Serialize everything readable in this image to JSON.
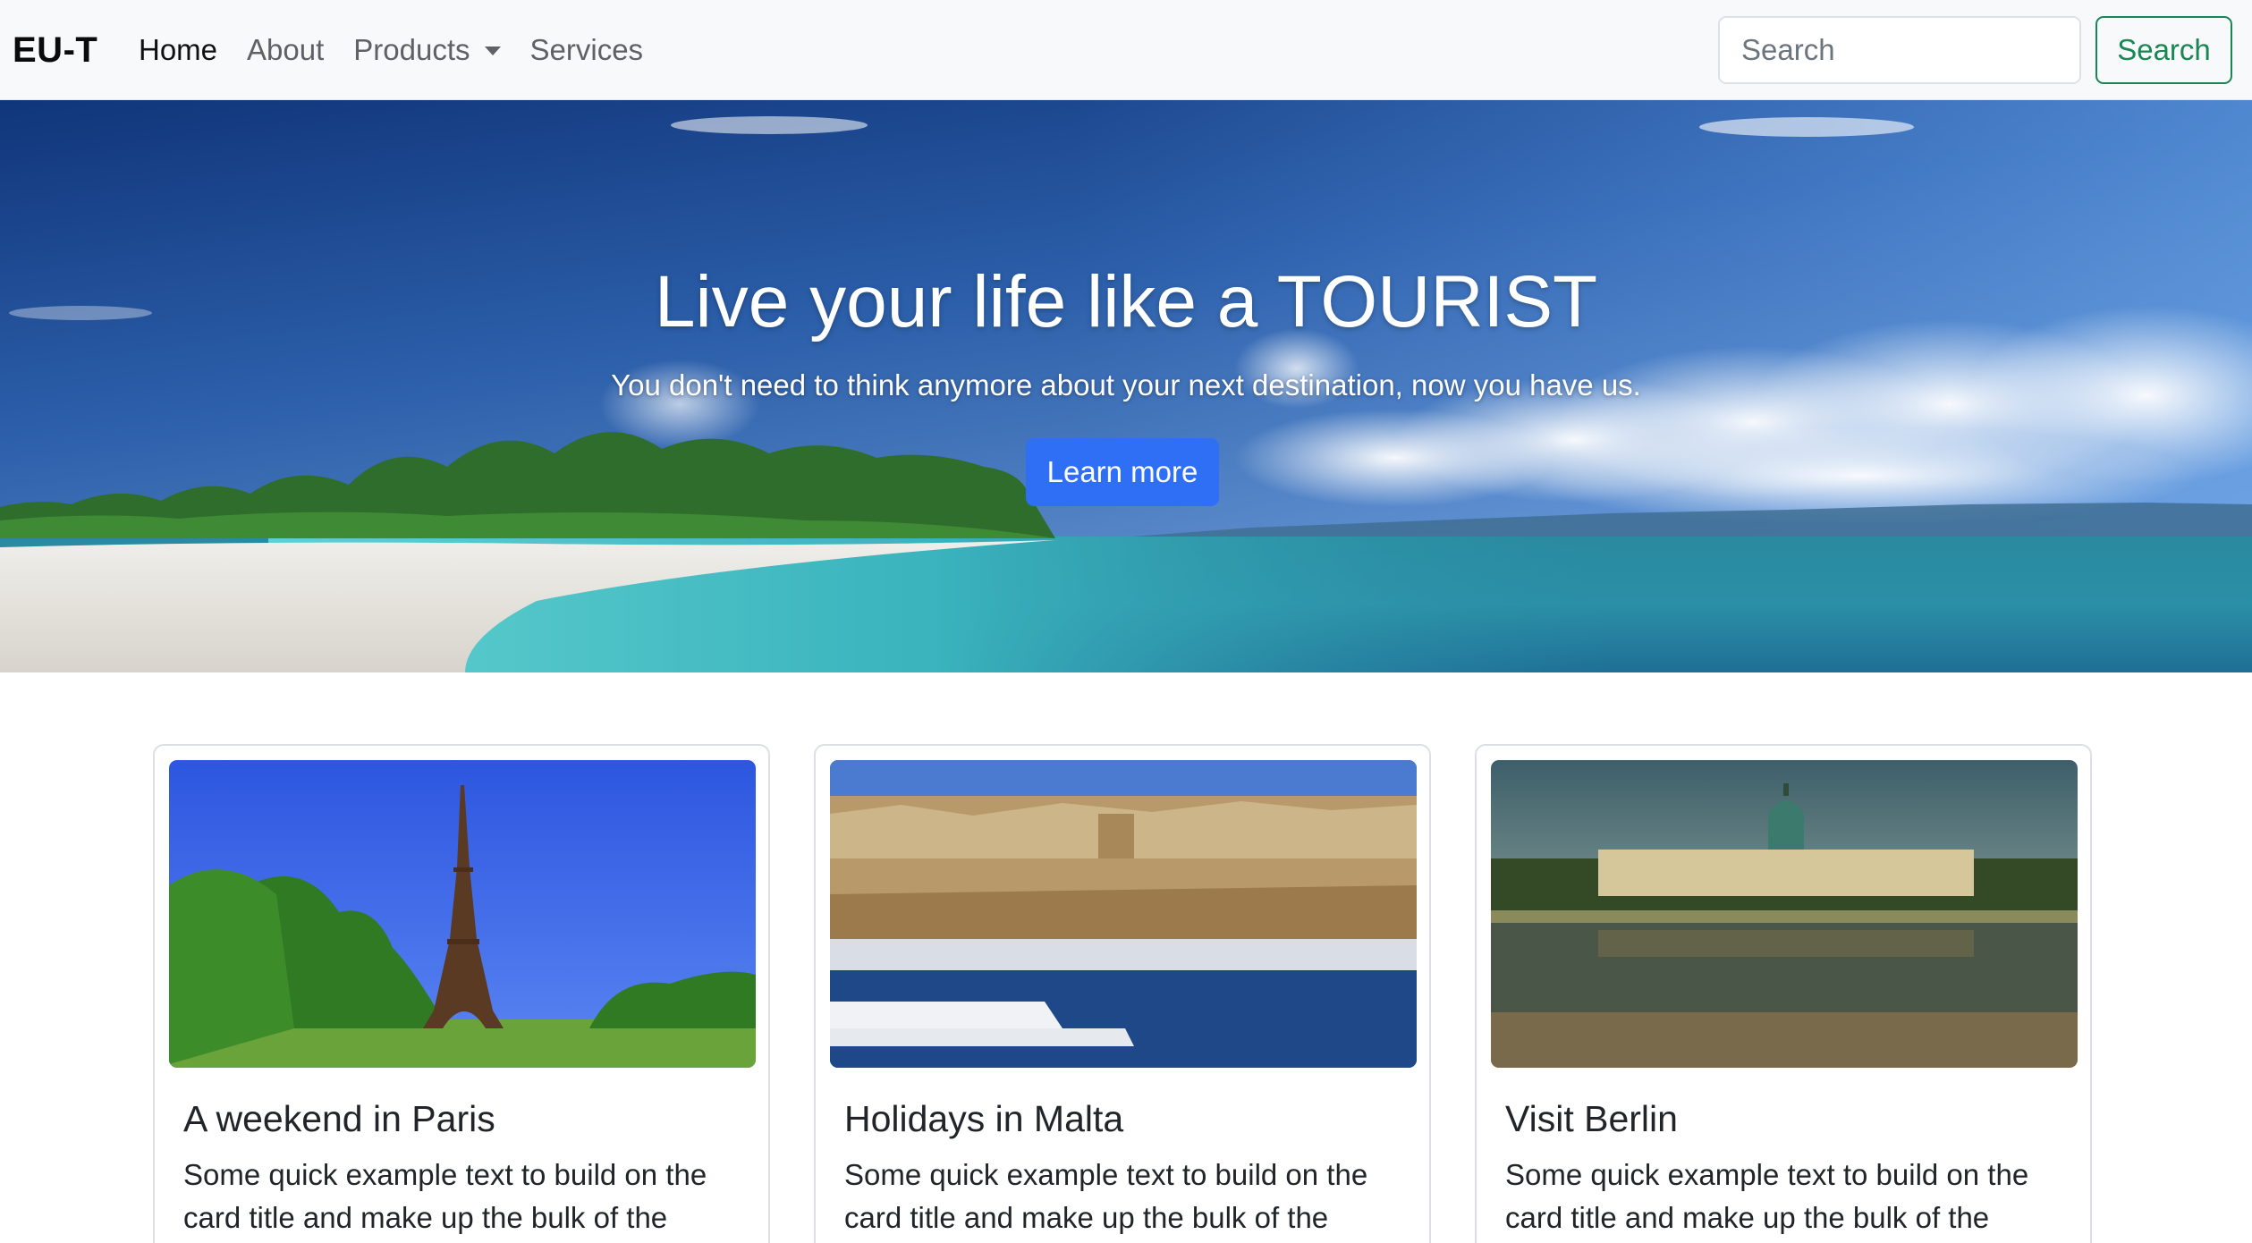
{
  "navbar": {
    "brand": "EU-T",
    "links": [
      {
        "label": "Home",
        "active": true
      },
      {
        "label": "About",
        "active": false
      },
      {
        "label": "Products",
        "active": false,
        "dropdown": true
      },
      {
        "label": "Services",
        "active": false
      }
    ],
    "search_placeholder": "Search",
    "search_button": "Search"
  },
  "hero": {
    "title": "Live your life like a TOURIST",
    "subtitle": "You don't need to think anymore about your next destination, now you have us.",
    "button": "Learn more"
  },
  "cards": [
    {
      "title": "A weekend in Paris",
      "text": "Some quick example text to build on the card title and make up the bulk of the"
    },
    {
      "title": "Holidays in Malta",
      "text": "Some quick example text to build on the card title and make up the bulk of the"
    },
    {
      "title": "Visit Berlin",
      "text": "Some quick example text to build on the card title and make up the bulk of the"
    }
  ],
  "colors": {
    "navbar_bg": "#f8f9fa",
    "primary": "#2f6ff5",
    "success": "#198754",
    "text": "#212529",
    "muted_link": "#5e6166"
  }
}
